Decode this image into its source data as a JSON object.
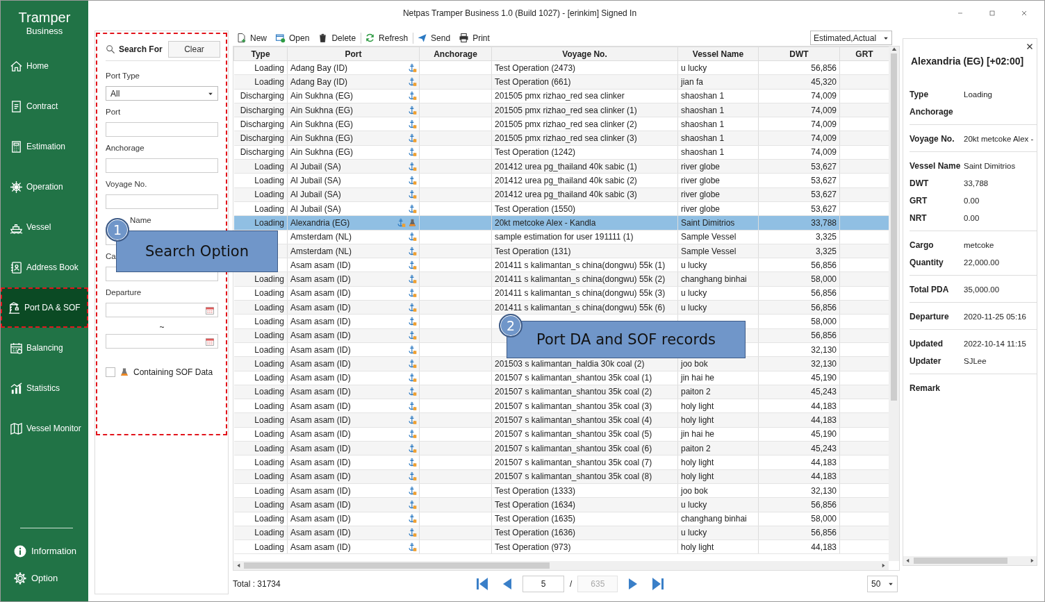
{
  "window": {
    "title": "Netpas Tramper Business 1.0 (Build 1027) - [erinkim] Signed In"
  },
  "sidebar": {
    "logo_title": "Tramper",
    "logo_subtitle": "Business",
    "items": [
      {
        "label": "Home",
        "selected": false
      },
      {
        "label": "Contract",
        "selected": false
      },
      {
        "label": "Estimation",
        "selected": false
      },
      {
        "label": "Operation",
        "selected": false
      },
      {
        "label": "Vessel",
        "selected": false
      },
      {
        "label": "Address Book",
        "selected": false
      },
      {
        "label": "Port DA & SOF",
        "selected": true
      },
      {
        "label": "Balancing",
        "selected": false
      },
      {
        "label": "Statistics",
        "selected": false
      },
      {
        "label": "Vessel Monitor",
        "selected": false
      }
    ],
    "bottom_items": [
      {
        "label": "Information"
      },
      {
        "label": "Option"
      }
    ]
  },
  "search_panel": {
    "title": "Search For",
    "clear_button": "Clear",
    "fields": [
      {
        "kind": "dropdown",
        "label": "Port Type",
        "value": "All"
      },
      {
        "kind": "text",
        "label": "Port"
      },
      {
        "kind": "text",
        "label": "Anchorage"
      },
      {
        "kind": "text",
        "label": "Voyage No."
      },
      {
        "kind": "text",
        "label": "Name",
        "label_partly_covered": true
      },
      {
        "kind": "text",
        "label": "Ca"
      },
      {
        "kind": "date",
        "label": "Departure"
      },
      {
        "kind": "separator",
        "label": "~"
      },
      {
        "kind": "date"
      },
      {
        "kind": "checkbox",
        "label": "Containing SOF Data",
        "checked": false
      }
    ]
  },
  "toolbar": {
    "buttons": [
      {
        "label": "New"
      },
      {
        "label": "Open"
      },
      {
        "label": "Delete"
      },
      {
        "label": "Refresh"
      },
      {
        "label": "Send"
      },
      {
        "label": "Print"
      }
    ],
    "view_filter": "Estimated,Actual"
  },
  "table": {
    "columns": [
      "Type",
      "Port",
      "Anchorage",
      "Voyage No.",
      "Vessel Name",
      "DWT",
      "GRT"
    ],
    "rows": [
      {
        "type": "Loading",
        "port": "Adang Bay (ID)",
        "voyage": "Test Operation (2473)",
        "vessel": "u lucky",
        "dwt": "56,856",
        "sof": false,
        "selected": false
      },
      {
        "type": "Loading",
        "port": "Adang Bay (ID)",
        "voyage": "Test Operation (661)",
        "vessel": "jian fa",
        "dwt": "45,320",
        "sof": false,
        "selected": false
      },
      {
        "type": "Discharging",
        "port": "Ain Sukhna (EG)",
        "voyage": "201505 pmx rizhao_red sea clinker",
        "vessel": "shaoshan 1",
        "dwt": "74,009",
        "sof": false,
        "selected": false
      },
      {
        "type": "Discharging",
        "port": "Ain Sukhna (EG)",
        "voyage": "201505 pmx rizhao_red sea clinker (1)",
        "vessel": "shaoshan 1",
        "dwt": "74,009",
        "sof": false,
        "selected": false
      },
      {
        "type": "Discharging",
        "port": "Ain Sukhna (EG)",
        "voyage": "201505 pmx rizhao_red sea clinker (2)",
        "vessel": "shaoshan 1",
        "dwt": "74,009",
        "sof": false,
        "selected": false
      },
      {
        "type": "Discharging",
        "port": "Ain Sukhna (EG)",
        "voyage": "201505 pmx rizhao_red sea clinker (3)",
        "vessel": "shaoshan 1",
        "dwt": "74,009",
        "sof": false,
        "selected": false
      },
      {
        "type": "Discharging",
        "port": "Ain Sukhna (EG)",
        "voyage": "Test Operation (1242)",
        "vessel": "shaoshan 1",
        "dwt": "74,009",
        "sof": false,
        "selected": false
      },
      {
        "type": "Loading",
        "port": "Al Jubail (SA)",
        "voyage": "201412 urea pg_thailand 40k sabic (1)",
        "vessel": "river globe",
        "dwt": "53,627",
        "sof": false,
        "selected": false
      },
      {
        "type": "Loading",
        "port": "Al Jubail (SA)",
        "voyage": "201412 urea pg_thailand 40k sabic (2)",
        "vessel": "river globe",
        "dwt": "53,627",
        "sof": false,
        "selected": false
      },
      {
        "type": "Loading",
        "port": "Al Jubail (SA)",
        "voyage": "201412 urea pg_thailand 40k sabic (3)",
        "vessel": "river globe",
        "dwt": "53,627",
        "sof": false,
        "selected": false
      },
      {
        "type": "Loading",
        "port": "Al Jubail (SA)",
        "voyage": "Test Operation (1550)",
        "vessel": "river globe",
        "dwt": "53,627",
        "sof": false,
        "selected": false
      },
      {
        "type": "Loading",
        "port": "Alexandria (EG)",
        "voyage": "20kt metcoke Alex - Kandla",
        "vessel": "Saint Dimitrios",
        "dwt": "33,788",
        "sof": true,
        "selected": true
      },
      {
        "port": "Amsterdam (NL)",
        "voyage": "sample estimation for user 191111 (1)",
        "vessel": "Sample Vessel",
        "dwt": "3,325",
        "sof": false,
        "selected": false
      },
      {
        "port": "Amsterdam (NL)",
        "voyage": "Test Operation (131)",
        "vessel": "Sample Vessel",
        "dwt": "3,325",
        "sof": false,
        "selected": false
      },
      {
        "port": "Asam asam (ID)",
        "voyage": "201411 s kalimantan_s china(dongwu) 55k (1)",
        "vessel": "u lucky",
        "dwt": "56,856",
        "sof": false,
        "selected": false
      },
      {
        "type": "Loading",
        "port": "Asam asam (ID)",
        "voyage": "201411 s kalimantan_s china(dongwu) 55k (2)",
        "vessel": "changhang binhai",
        "dwt": "58,000",
        "sof": false,
        "selected": false
      },
      {
        "type": "Loading",
        "port": "Asam asam (ID)",
        "voyage": "201411 s kalimantan_s china(dongwu) 55k (3)",
        "vessel": "u lucky",
        "dwt": "56,856",
        "sof": false,
        "selected": false
      },
      {
        "type": "Loading",
        "port": "Asam asam (ID)",
        "voyage": "201411 s kalimantan_s china(dongwu) 55k (6)",
        "vessel": "u lucky",
        "dwt": "56,856",
        "sof": false,
        "selected": false
      },
      {
        "type": "Loading",
        "port": "Asam asam (ID)",
        "dwt": "58,000",
        "sof": false,
        "selected": false
      },
      {
        "type": "Loading",
        "port": "Asam asam (ID)",
        "dwt": "56,856",
        "sof": false,
        "selected": false
      },
      {
        "type": "Loading",
        "port": "Asam asam (ID)",
        "dwt": "32,130",
        "sof": false,
        "selected": false
      },
      {
        "type": "Loading",
        "port": "Asam asam (ID)",
        "voyage": "201503 s kalimantan_haldia 30k coal (2)",
        "vessel": "joo bok",
        "dwt": "32,130",
        "sof": false,
        "selected": false
      },
      {
        "type": "Loading",
        "port": "Asam asam (ID)",
        "voyage": "201507 s kalimantan_shantou 35k coal (1)",
        "vessel": "jin hai he",
        "dwt": "45,190",
        "sof": false,
        "selected": false
      },
      {
        "type": "Loading",
        "port": "Asam asam (ID)",
        "voyage": "201507 s kalimantan_shantou 35k coal (2)",
        "vessel": "paiton 2",
        "dwt": "45,243",
        "sof": false,
        "selected": false
      },
      {
        "type": "Loading",
        "port": "Asam asam (ID)",
        "voyage": "201507 s kalimantan_shantou 35k coal (3)",
        "vessel": "holy light",
        "dwt": "44,183",
        "sof": false,
        "selected": false
      },
      {
        "type": "Loading",
        "port": "Asam asam (ID)",
        "voyage": "201507 s kalimantan_shantou 35k coal (4)",
        "vessel": "holy light",
        "dwt": "44,183",
        "sof": false,
        "selected": false
      },
      {
        "type": "Loading",
        "port": "Asam asam (ID)",
        "voyage": "201507 s kalimantan_shantou 35k coal (5)",
        "vessel": "jin hai he",
        "dwt": "45,190",
        "sof": false,
        "selected": false
      },
      {
        "type": "Loading",
        "port": "Asam asam (ID)",
        "voyage": "201507 s kalimantan_shantou 35k coal (6)",
        "vessel": "paiton 2",
        "dwt": "45,243",
        "sof": false,
        "selected": false
      },
      {
        "type": "Loading",
        "port": "Asam asam (ID)",
        "voyage": "201507 s kalimantan_shantou 35k coal (7)",
        "vessel": "holy light",
        "dwt": "44,183",
        "sof": false,
        "selected": false
      },
      {
        "type": "Loading",
        "port": "Asam asam (ID)",
        "voyage": "201507 s kalimantan_shantou 35k coal (8)",
        "vessel": "holy light",
        "dwt": "44,183",
        "sof": false,
        "selected": false
      },
      {
        "type": "Loading",
        "port": "Asam asam (ID)",
        "voyage": "Test Operation (1333)",
        "vessel": "joo bok",
        "dwt": "32,130",
        "sof": false,
        "selected": false
      },
      {
        "type": "Loading",
        "port": "Asam asam (ID)",
        "voyage": "Test Operation (1634)",
        "vessel": "u lucky",
        "dwt": "56,856",
        "sof": false,
        "selected": false
      },
      {
        "type": "Loading",
        "port": "Asam asam (ID)",
        "voyage": "Test Operation (1635)",
        "vessel": "changhang binhai",
        "dwt": "58,000",
        "sof": false,
        "selected": false
      },
      {
        "type": "Loading",
        "port": "Asam asam (ID)",
        "voyage": "Test Operation (1636)",
        "vessel": "u lucky",
        "dwt": "56,856",
        "sof": false,
        "selected": false
      },
      {
        "type": "Loading",
        "port": "Asam asam (ID)",
        "voyage": "Test Operation (973)",
        "vessel": "holy light",
        "dwt": "44,183",
        "sof": false,
        "selected": false
      }
    ]
  },
  "footer": {
    "total": "Total : 31734",
    "page": "5",
    "separator": "/",
    "page_count": "635",
    "page_size": "50"
  },
  "detail_panel": {
    "title": "Alexandria (EG) [+02:00]",
    "groups": [
      [
        {
          "label": "Type",
          "value": "Loading"
        },
        {
          "label": "Anchorage"
        }
      ],
      [
        {
          "label": "Voyage No.",
          "value": "20kt metcoke Alex -"
        }
      ],
      [
        {
          "label": "Vessel Name",
          "value": "Saint Dimitrios"
        },
        {
          "label": "DWT",
          "value": "33,788"
        },
        {
          "label": "GRT",
          "value": "0.00"
        },
        {
          "label": "NRT",
          "value": "0.00"
        }
      ],
      [
        {
          "label": "Cargo",
          "value": "metcoke"
        },
        {
          "label": "Quantity",
          "value": "22,000.00"
        }
      ],
      [
        {
          "label": "Total PDA",
          "value": "35,000.00"
        }
      ],
      [
        {
          "label": "Departure",
          "value": "2020-11-25 05:16"
        }
      ],
      [
        {
          "label": "Updated",
          "value": "2022-10-14 11:15"
        },
        {
          "label": "Updater",
          "value": "SJLee"
        }
      ],
      [
        {
          "label": "Remark"
        }
      ]
    ]
  },
  "callouts": [
    {
      "number": "1",
      "text": "Search Option"
    },
    {
      "number": "2",
      "text": "Port DA and SOF records"
    }
  ]
}
